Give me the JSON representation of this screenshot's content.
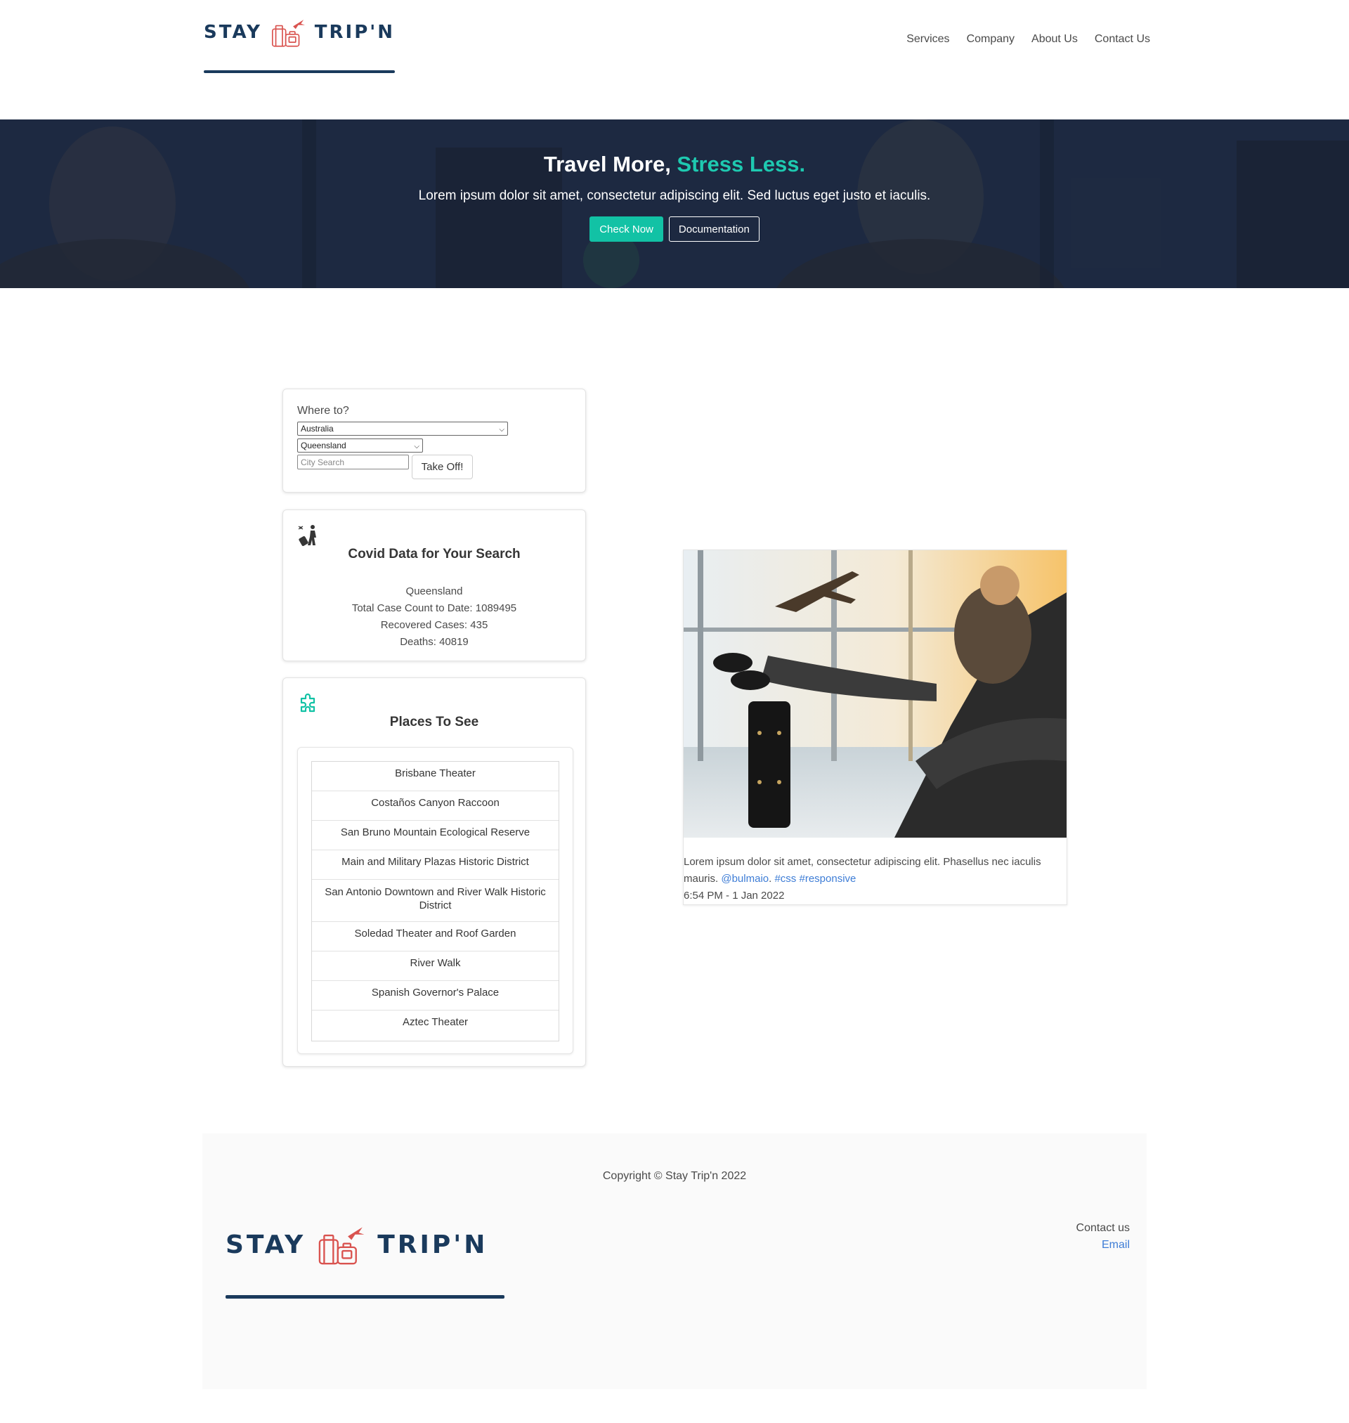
{
  "brand": {
    "name_left": "STAY",
    "name_right": "TRIP'N",
    "color_primary": "#1a3a5c",
    "color_accent": "#12c2a5",
    "color_logo_icon": "#d9534f"
  },
  "nav": {
    "items": [
      {
        "label": "Services"
      },
      {
        "label": "Company"
      },
      {
        "label": "About Us"
      },
      {
        "label": "Contact Us"
      }
    ]
  },
  "hero": {
    "title_main": "Travel More, ",
    "title_accent": "Stress Less.",
    "subtitle": "Lorem ipsum dolor sit amet, consectetur adipiscing elit. Sed luctus eget justo et iaculis.",
    "primary_button": "Check Now",
    "secondary_button": "Documentation"
  },
  "search": {
    "label": "Where to?",
    "country_selected": "Australia",
    "region_selected": "Queensland",
    "city_placeholder": "City Search",
    "submit_label": "Take Off!"
  },
  "covid": {
    "icon": "traveler-icon",
    "title": "Covid Data for Your Search",
    "region": "Queensland",
    "total_cases": "Total Case Count to Date: 1089495",
    "recovered": "Recovered Cases: 435",
    "deaths": "Deaths: 40819"
  },
  "places": {
    "icon": "puzzle-icon",
    "title": "Places To See",
    "items": [
      {
        "label": "Brisbane Theater"
      },
      {
        "label": "Costaños Canyon Raccoon"
      },
      {
        "label": "San Bruno Mountain Ecological Reserve"
      },
      {
        "label": "Main and Military Plazas Historic District"
      },
      {
        "label": "San Antonio Downtown and River Walk Historic District"
      },
      {
        "label": "Soledad Theater and Roof Garden"
      },
      {
        "label": "River Walk"
      },
      {
        "label": "Spanish Governor's Palace"
      },
      {
        "label": "Aztec Theater"
      }
    ]
  },
  "post": {
    "text": "Lorem ipsum dolor sit amet, consectetur adipiscing elit. Phasellus nec iaculis mauris.",
    "mention": "@bulmaio",
    "tag1": "#css",
    "tag2": "#responsive",
    "timestamp": "6:54 PM - 1 Jan 2022"
  },
  "footer": {
    "copyright": "Copyright © Stay Trip'n 2022",
    "contact_label": "Contact us",
    "email_label": "Email"
  }
}
